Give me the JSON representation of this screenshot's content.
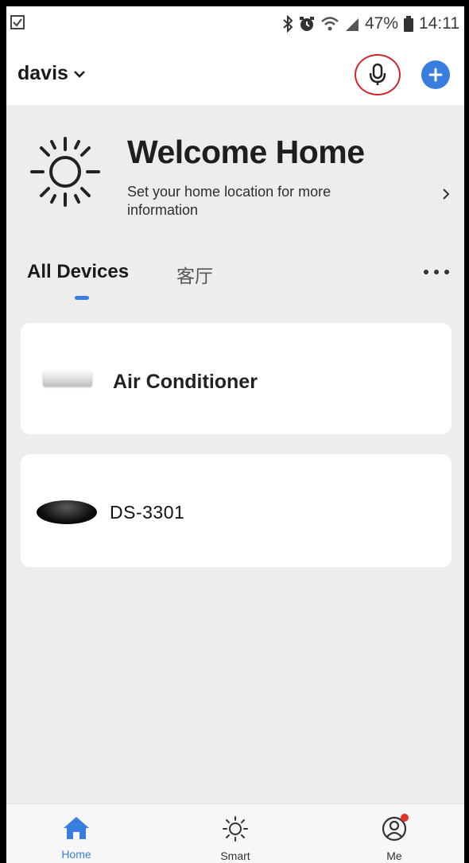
{
  "status_bar": {
    "battery": "47%",
    "time": "14:11"
  },
  "header": {
    "home_name": "davis"
  },
  "welcome": {
    "title": "Welcome Home",
    "subtitle": "Set your home location for more information"
  },
  "tabs": {
    "all_devices": "All Devices",
    "room": "客厅"
  },
  "devices": [
    {
      "name": "Air Conditioner"
    },
    {
      "name": "DS-3301"
    }
  ],
  "bottom_nav": {
    "home": "Home",
    "smart": "Smart",
    "me": "Me"
  },
  "colors": {
    "accent": "#3a7de0",
    "mic_highlight": "#d0262b",
    "badge": "#e5332a"
  },
  "icons": {
    "mic": "microphone-icon",
    "add": "plus-icon",
    "weather": "sun-icon",
    "home_nav": "house-icon",
    "smart_nav": "sun-outline-icon",
    "me_nav": "user-icon"
  }
}
